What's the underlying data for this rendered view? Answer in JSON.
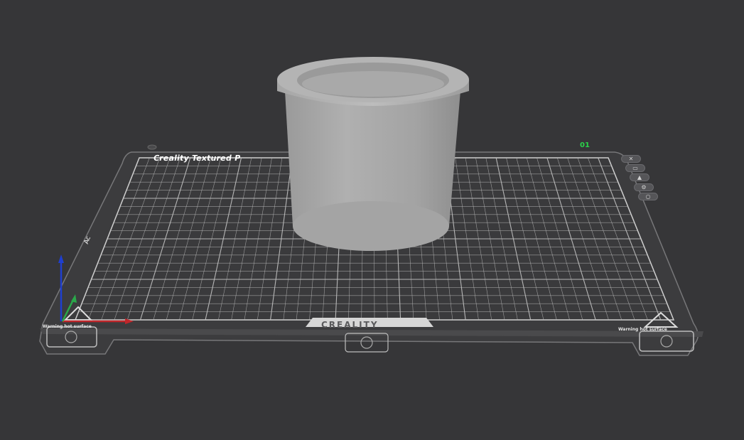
{
  "plate": {
    "title": "Creality Textured P",
    "number": "01",
    "brand": "CREALITY",
    "warning_left": "Warning hot surface",
    "warning_right": "Warning hot surface",
    "side_label": "Ac"
  },
  "toolbar": {
    "buttons": [
      {
        "name": "close-view-button",
        "icon": "✕"
      },
      {
        "name": "arrange-button",
        "icon": "▭"
      },
      {
        "name": "orient-button",
        "icon": "▲"
      },
      {
        "name": "settings-button",
        "icon": "⚙"
      },
      {
        "name": "lock-button",
        "icon": "○"
      }
    ]
  },
  "colors": {
    "background": "#363638",
    "plate": "#3b3b3d",
    "grid": "#bdbdbd",
    "model": "#a8a8a8",
    "axis_x": "#c0262a",
    "axis_y": "#2aa84a",
    "axis_z": "#1f3fd0",
    "plate_number": "#2ad44a"
  }
}
